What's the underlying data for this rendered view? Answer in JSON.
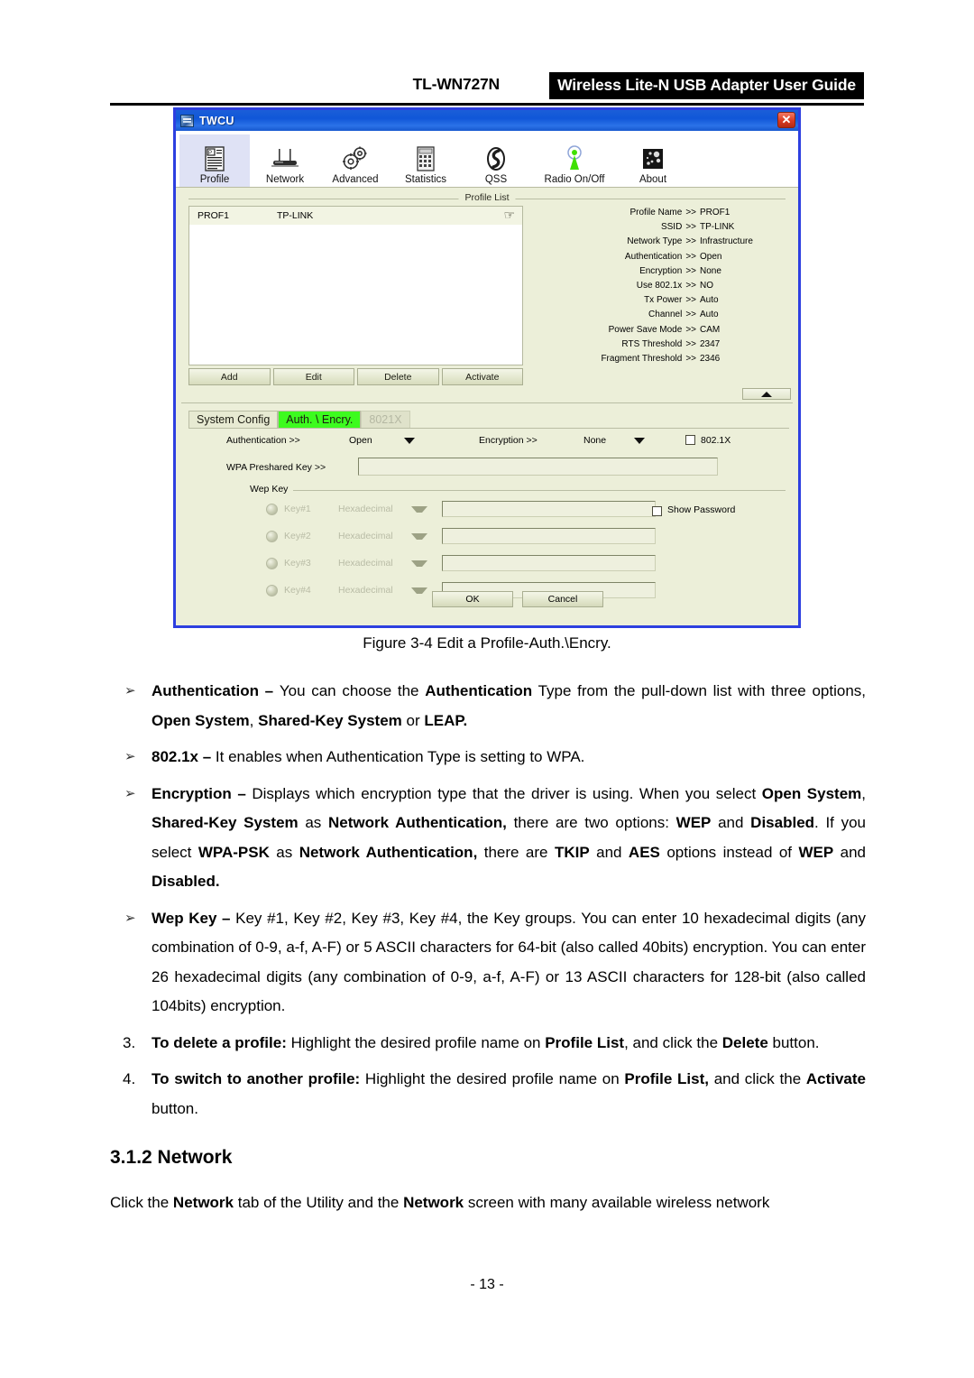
{
  "header": {
    "model": "TL-WN727N",
    "band_title": "Wireless Lite-N USB Adapter User Guide"
  },
  "screenshot": {
    "window_title": "TWCU",
    "close_label": "✕",
    "toolbar": [
      {
        "label": "Profile",
        "icon": "profile-icon",
        "active": true
      },
      {
        "label": "Network",
        "icon": "router-icon",
        "active": false
      },
      {
        "label": "Advanced",
        "icon": "gears-icon",
        "active": false
      },
      {
        "label": "Statistics",
        "icon": "calculator-icon",
        "active": false
      },
      {
        "label": "QSS",
        "icon": "qss-icon",
        "active": false
      },
      {
        "label": "Radio On/Off",
        "icon": "antenna-icon",
        "active": false
      },
      {
        "label": "About",
        "icon": "about-icon",
        "active": false
      }
    ],
    "profile_list": {
      "group_label": "Profile List",
      "rows": [
        {
          "name": "PROF1",
          "ssid": "TP-LINK"
        }
      ],
      "buttons": [
        "Add",
        "Edit",
        "Delete",
        "Activate"
      ]
    },
    "details": [
      {
        "key": "Profile Name",
        "sep": ">>",
        "value": "PROF1"
      },
      {
        "key": "SSID",
        "sep": ">>",
        "value": "TP-LINK"
      },
      {
        "key": "Network Type",
        "sep": ">>",
        "value": "Infrastructure"
      },
      {
        "key": "Authentication",
        "sep": ">>",
        "value": "Open"
      },
      {
        "key": "Encryption",
        "sep": ">>",
        "value": "None"
      },
      {
        "key": "Use 802.1x",
        "sep": ">>",
        "value": "NO"
      },
      {
        "key": "Tx Power",
        "sep": ">>",
        "value": "Auto"
      },
      {
        "key": "Channel",
        "sep": ">>",
        "value": "Auto"
      },
      {
        "key": "Power Save Mode",
        "sep": ">>",
        "value": "CAM"
      },
      {
        "key": "RTS Threshold",
        "sep": ">>",
        "value": "2347"
      },
      {
        "key": "Fragment Threshold",
        "sep": ">>",
        "value": "2346"
      }
    ],
    "tabs": [
      {
        "label": "System Config",
        "state": "plain"
      },
      {
        "label": "Auth. \\ Encry.",
        "state": "selected"
      },
      {
        "label": "8021X",
        "state": "disabled"
      }
    ],
    "auth": {
      "authentication_label": "Authentication >>",
      "authentication_value": "Open",
      "encryption_label": "Encryption >>",
      "encryption_value": "None",
      "dot1x_label": "802.1X",
      "wpa_label": "WPA Preshared Key >>",
      "wpa_value": ""
    },
    "wep": {
      "group_label": "Wep Key",
      "keys": [
        {
          "label": "Key#1",
          "format": "Hexadecimal",
          "value": ""
        },
        {
          "label": "Key#2",
          "format": "Hexadecimal",
          "value": ""
        },
        {
          "label": "Key#3",
          "format": "Hexadecimal",
          "value": ""
        },
        {
          "label": "Key#4",
          "format": "Hexadecimal",
          "value": ""
        }
      ],
      "show_password_label": "Show Password"
    },
    "footer_buttons": {
      "ok": "OK",
      "cancel": "Cancel"
    }
  },
  "figure_caption": "Figure 3-4 Edit a Profile-Auth.\\Encry.",
  "bullets": [
    {
      "marker": "➢"
    },
    {
      "marker": "➢"
    },
    {
      "marker": "➢"
    },
    {
      "marker": "➢"
    }
  ],
  "numbered": [
    {
      "marker": "3."
    },
    {
      "marker": "4."
    }
  ],
  "section": {
    "heading": "3.1.2 Network",
    "paragraph_prefix": "Click the ",
    "paragraph_b1": "Network",
    "paragraph_mid": " tab of the Utility and the ",
    "paragraph_b2": "Network",
    "paragraph_suffix": " screen with many available wireless network"
  },
  "text": {
    "b1_title": "Authentication – ",
    "b1_p1": "You can choose the ",
    "b1_b1": "Authentication",
    "b1_p2": " Type from the pull-down list with three options, ",
    "b1_b2": "Open System",
    "b1_p3": ", ",
    "b1_b3": "Shared-Key System",
    "b1_p4": " or ",
    "b1_b4": "LEAP.",
    "b2_title": "802.1x – ",
    "b2_p1": "It enables when Authentication Type is setting to WPA.",
    "b3_title": "Encryption – ",
    "b3_p1": "Displays which encryption type that the driver is using. When you select ",
    "b3_b1": "Open System",
    "b3_p2": ", ",
    "b3_b2": "Shared-Key System",
    "b3_p3": " as ",
    "b3_b3": "Network Authentication,",
    "b3_p4": " there are two options: ",
    "b3_b4": "WEP",
    "b3_p5": " and ",
    "b3_b5": "Disabled",
    "b3_p6": ". If you select ",
    "b3_b6": "WPA-PSK",
    "b3_p7": " as ",
    "b3_b7": "Network Authentication,",
    "b3_p8": " there are ",
    "b3_b8": "TKIP",
    "b3_p9": " and ",
    "b3_b9": "AES",
    "b3_p10": " options instead of ",
    "b3_b10": "WEP",
    "b3_p11": " and ",
    "b3_b11": "Disabled.",
    "b4_title": "Wep Key – ",
    "b4_p1": "Key #1, Key #2, Key #3, Key #4, the Key groups. You can enter 10 hexadecimal digits (any combination of 0-9, a-f, A-F) or 5 ASCII characters for 64-bit (also called 40bits) encryption. You can enter 26 hexadecimal digits (any combination of 0-9, a-f, A-F) or 13 ASCII characters for 128-bit (also called 104bits) encryption.",
    "n3_title": "To delete a profile:",
    "n3_p1": " Highlight the desired profile name on ",
    "n3_b1": "Profile List",
    "n3_p2": ", and click the ",
    "n3_b2": "Delete",
    "n3_p3": " button.",
    "n4_title": "To switch to another profile:",
    "n4_p1": " Highlight the desired profile name on ",
    "n4_b1": "Profile List,",
    "n4_p2": " and click the ",
    "n4_b2": "Activate",
    "n4_p3": " button."
  },
  "page_number": "- 13 -"
}
